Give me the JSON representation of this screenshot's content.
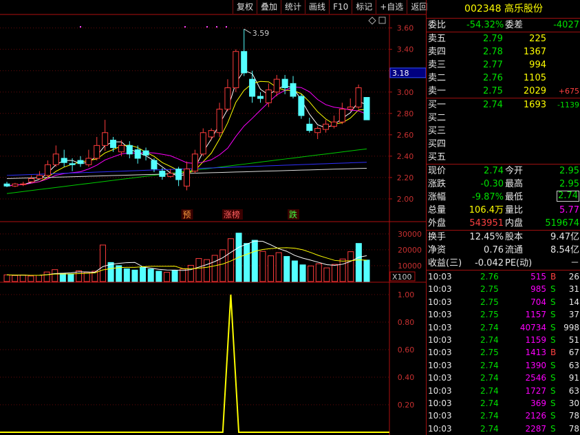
{
  "toolbar": [
    "复权",
    "叠加",
    "统计",
    "画线",
    "F10",
    "标记",
    "+自选",
    "返回"
  ],
  "stock": {
    "code": "002348",
    "name": "高乐股份"
  },
  "order_book": {
    "webi_label": "委比",
    "webi": "-54.32%",
    "weicha_label": "委差",
    "weicha": "-4027",
    "asks": [
      {
        "label": "卖五",
        "price": "2.79",
        "vol": "225",
        "chg": ""
      },
      {
        "label": "卖四",
        "price": "2.78",
        "vol": "1367",
        "chg": ""
      },
      {
        "label": "卖三",
        "price": "2.77",
        "vol": "994",
        "chg": ""
      },
      {
        "label": "卖二",
        "price": "2.76",
        "vol": "1105",
        "chg": ""
      },
      {
        "label": "卖一",
        "price": "2.75",
        "vol": "2029",
        "chg": "+675"
      }
    ],
    "bids": [
      {
        "label": "买一",
        "price": "2.74",
        "vol": "1693",
        "chg": "-1139"
      },
      {
        "label": "买二",
        "price": "",
        "vol": "",
        "chg": ""
      },
      {
        "label": "买三",
        "price": "",
        "vol": "",
        "chg": ""
      },
      {
        "label": "买四",
        "price": "",
        "vol": "",
        "chg": ""
      },
      {
        "label": "买五",
        "price": "",
        "vol": "",
        "chg": ""
      }
    ]
  },
  "quote": [
    {
      "l1": "现价",
      "v1": "2.74",
      "l2": "今开",
      "v2": "2.95",
      "c1": "g",
      "c2": "g",
      "box": false
    },
    {
      "l1": "涨跌",
      "v1": "-0.30",
      "l2": "最高",
      "v2": "2.95",
      "c1": "g",
      "c2": "g",
      "box": false
    },
    {
      "l1": "涨幅",
      "v1": "-9.87%",
      "l2": "最低",
      "v2": "2.74",
      "c1": "g",
      "c2": "g",
      "box": true
    },
    {
      "l1": "总量",
      "v1": "106.4万",
      "l2": "量比",
      "v2": "5.77",
      "c1": "y",
      "c2": "m",
      "box": false
    },
    {
      "l1": "外盘",
      "v1": "543951",
      "l2": "内盘",
      "v2": "519674",
      "c1": "r",
      "c2": "g",
      "box": false
    }
  ],
  "quote2": [
    {
      "l1": "换手",
      "v1": "12.45%",
      "l2": "股本",
      "v2": "9.47亿"
    },
    {
      "l1": "净资",
      "v1": "0.76",
      "l2": "流通",
      "v2": "8.54亿"
    },
    {
      "l1": "收益(三)",
      "v1": "-0.042",
      "l2": "PE(动)",
      "v2": "－"
    }
  ],
  "ticks": [
    {
      "t": "10:03",
      "p": "2.76",
      "v": "515",
      "s": "B",
      "n": "26"
    },
    {
      "t": "10:03",
      "p": "2.75",
      "v": "985",
      "s": "S",
      "n": "31"
    },
    {
      "t": "10:03",
      "p": "2.75",
      "v": "704",
      "s": "S",
      "n": "14"
    },
    {
      "t": "10:03",
      "p": "2.75",
      "v": "1157",
      "s": "S",
      "n": "37"
    },
    {
      "t": "10:03",
      "p": "2.74",
      "v": "40734",
      "s": "S",
      "n": "998"
    },
    {
      "t": "10:03",
      "p": "2.74",
      "v": "1159",
      "s": "S",
      "n": "51"
    },
    {
      "t": "10:03",
      "p": "2.75",
      "v": "1413",
      "s": "B",
      "n": "67"
    },
    {
      "t": "10:03",
      "p": "2.74",
      "v": "1390",
      "s": "S",
      "n": "63"
    },
    {
      "t": "10:03",
      "p": "2.74",
      "v": "2546",
      "s": "S",
      "n": "91"
    },
    {
      "t": "10:03",
      "p": "2.74",
      "v": "1727",
      "s": "S",
      "n": "63"
    },
    {
      "t": "10:03",
      "p": "2.74",
      "v": "369",
      "s": "S",
      "n": "30"
    },
    {
      "t": "10:03",
      "p": "2.74",
      "v": "2126",
      "s": "S",
      "n": "78"
    },
    {
      "t": "10:03",
      "p": "2.74",
      "v": "2287",
      "s": "S",
      "n": "78"
    }
  ],
  "chart_data": [
    {
      "type": "candlestick",
      "y_ticks": [
        "3.60",
        "3.40",
        "3.20",
        "3.00",
        "2.80",
        "2.60",
        "2.40",
        "2.20",
        "2.00"
      ],
      "y_tick_values": [
        3.6,
        3.4,
        3.2,
        3.0,
        2.8,
        2.6,
        2.4,
        2.2,
        2.0
      ],
      "ylim": [
        1.8,
        3.72
      ],
      "current_price_tag": "3.18",
      "high_annotation": "3.59",
      "event_labels": [
        {
          "text": "预",
          "index": 22,
          "color": "#ffa040"
        },
        {
          "text": "涨榜",
          "index": 27,
          "color": "#ff6060"
        },
        {
          "text": "跌",
          "index": 35,
          "color": "#40ff40"
        }
      ],
      "candles": [
        [
          2.14,
          2.12,
          2.16,
          2.11
        ],
        [
          2.12,
          2.14,
          2.15,
          2.11
        ],
        [
          2.14,
          2.14,
          2.16,
          2.12
        ],
        [
          2.16,
          2.19,
          2.22,
          2.15
        ],
        [
          2.19,
          2.22,
          2.26,
          2.18
        ],
        [
          2.22,
          2.32,
          2.36,
          2.2
        ],
        [
          2.32,
          2.42,
          2.5,
          2.3
        ],
        [
          2.38,
          2.34,
          2.46,
          2.3
        ],
        [
          2.33,
          2.32,
          2.38,
          2.26
        ],
        [
          2.36,
          2.33,
          2.4,
          2.3
        ],
        [
          2.32,
          2.38,
          2.46,
          2.3
        ],
        [
          2.38,
          2.5,
          2.58,
          2.36
        ],
        [
          2.5,
          2.62,
          2.74,
          2.45
        ],
        [
          2.55,
          2.48,
          2.58,
          2.44
        ],
        [
          2.44,
          2.5,
          2.55,
          2.4
        ],
        [
          2.5,
          2.42,
          2.54,
          2.38
        ],
        [
          2.46,
          2.38,
          2.5,
          2.33
        ],
        [
          2.45,
          2.41,
          2.48,
          2.36
        ],
        [
          2.36,
          2.28,
          2.38,
          2.25
        ],
        [
          2.26,
          2.21,
          2.29,
          2.18
        ],
        [
          2.21,
          2.24,
          2.28,
          2.2
        ],
        [
          2.28,
          2.18,
          2.3,
          2.12
        ],
        [
          2.12,
          2.28,
          2.35,
          2.08
        ],
        [
          2.26,
          2.42,
          2.46,
          2.24
        ],
        [
          2.42,
          2.62,
          2.66,
          2.4
        ],
        [
          2.58,
          2.64,
          2.66,
          2.55
        ],
        [
          2.62,
          2.84,
          2.9,
          2.58
        ],
        [
          2.84,
          3.04,
          3.12,
          2.82
        ],
        [
          3.04,
          3.38,
          3.4,
          3.0
        ],
        [
          3.38,
          3.18,
          3.59,
          3.15
        ],
        [
          3.12,
          2.96,
          3.2,
          2.9
        ],
        [
          2.96,
          2.94,
          3.0,
          2.9
        ],
        [
          2.9,
          3.02,
          3.08,
          2.86
        ],
        [
          3.0,
          3.12,
          3.16,
          2.96
        ],
        [
          3.12,
          3.04,
          3.16,
          2.98
        ],
        [
          3.08,
          2.96,
          3.15,
          2.94
        ],
        [
          2.96,
          2.78,
          2.98,
          2.75
        ],
        [
          2.7,
          2.64,
          2.76,
          2.62
        ],
        [
          2.62,
          2.66,
          2.68,
          2.56
        ],
        [
          2.65,
          2.7,
          2.74,
          2.62
        ],
        [
          2.68,
          2.72,
          2.78,
          2.66
        ],
        [
          2.72,
          2.84,
          2.9,
          2.7
        ],
        [
          2.84,
          2.86,
          2.94,
          2.82
        ],
        [
          2.86,
          3.04,
          3.07,
          2.84
        ],
        [
          2.95,
          2.74,
          2.95,
          2.74
        ]
      ],
      "ma_colors": [
        "#ffffff",
        "#ffff00",
        "#ff00ff",
        "#00cc00",
        "#3030ff",
        "#dddddd"
      ]
    },
    {
      "type": "bar",
      "y_ticks": [
        "30000",
        "20000",
        "10000"
      ],
      "y_tick_values": [
        30000,
        20000,
        10000
      ],
      "ylim": [
        0,
        36000
      ],
      "unit_label": "X100",
      "values": [
        4200,
        3800,
        4100,
        3500,
        3900,
        6000,
        7500,
        5200,
        4800,
        6800,
        5800,
        6500,
        23000,
        12000,
        10000,
        8000,
        7200,
        9000,
        7800,
        6500,
        5800,
        7000,
        7900,
        10200,
        14500,
        13800,
        16500,
        20000,
        27000,
        30500,
        24000,
        26000,
        19000,
        16200,
        18200,
        15800,
        13000,
        10500,
        9800,
        11200,
        8600,
        10800,
        14200,
        18800,
        24000,
        13500
      ],
      "red_mask": [
        1,
        1,
        1,
        1,
        1,
        1,
        1,
        0,
        0,
        1,
        1,
        1,
        1,
        0,
        0,
        0,
        0,
        0,
        0,
        0,
        1,
        0,
        1,
        1,
        1,
        1,
        1,
        1,
        1,
        0,
        0,
        0,
        1,
        1,
        1,
        0,
        0,
        0,
        1,
        1,
        1,
        1,
        1,
        1,
        0,
        0
      ]
    },
    {
      "type": "line",
      "y_ticks": [
        "1.00",
        "0.80",
        "0.60",
        "0.40",
        "0.20"
      ],
      "y_tick_values": [
        1.0,
        0.8,
        0.6,
        0.4,
        0.2
      ],
      "ylim": [
        0,
        1.08
      ],
      "values": [
        0,
        0,
        0,
        0,
        0,
        0,
        0,
        0,
        0,
        0,
        0,
        0,
        0,
        0,
        0,
        0,
        0,
        0,
        0,
        0,
        0,
        0,
        0,
        0,
        0,
        0,
        0,
        0,
        1,
        0,
        0,
        0,
        0,
        0,
        0,
        0,
        0,
        0,
        0,
        0,
        0,
        0,
        0,
        0,
        0,
        0
      ]
    }
  ]
}
